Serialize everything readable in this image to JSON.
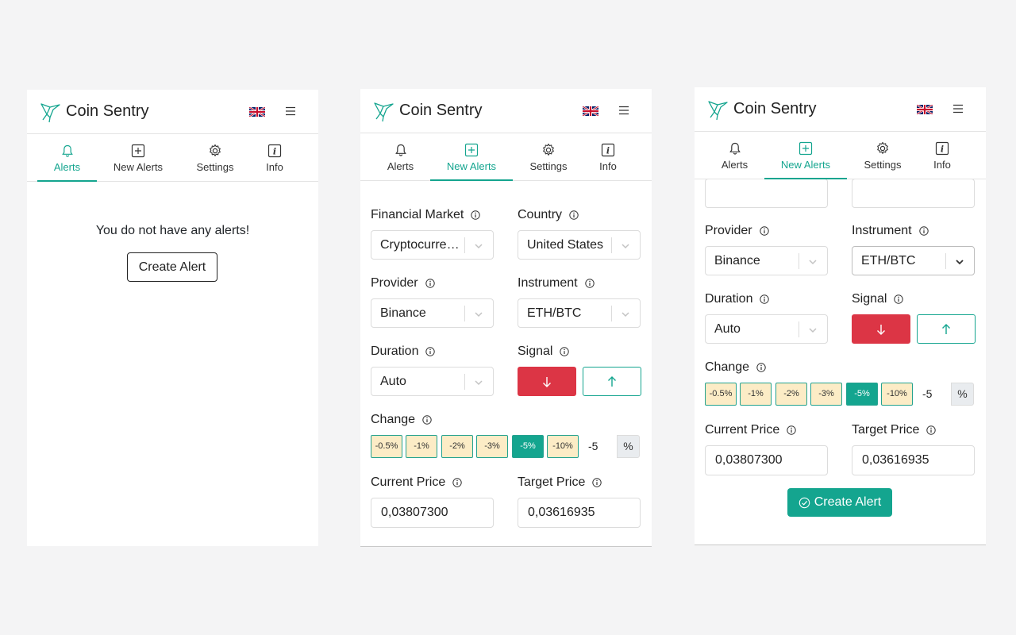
{
  "app": {
    "title": "Coin Sentry",
    "language": "English (UK)"
  },
  "tabs": {
    "alerts": "Alerts",
    "new_alerts": "New Alerts",
    "settings": "Settings",
    "info": "Info"
  },
  "alerts_view": {
    "empty_message": "You do not have any alerts!",
    "create_label": "Create Alert"
  },
  "form": {
    "financial_market": {
      "label": "Financial Market",
      "value": "Cryptocurrency"
    },
    "country": {
      "label": "Country",
      "value": "United States"
    },
    "provider": {
      "label": "Provider",
      "value": "Binance"
    },
    "instrument": {
      "label": "Instrument",
      "value": "ETH/BTC"
    },
    "duration": {
      "label": "Duration",
      "value": "Auto"
    },
    "signal": {
      "label": "Signal",
      "down": "↓",
      "up": "↑",
      "selected": "down"
    },
    "change": {
      "label": "Change",
      "options": [
        "-0.5%",
        "-1%",
        "-2%",
        "-3%",
        "-5%",
        "-10%"
      ],
      "selected": "-5%",
      "input_value": "-5",
      "unit": "%"
    },
    "current_price": {
      "label": "Current Price",
      "value": "0,03807300"
    },
    "target_price": {
      "label": "Target Price",
      "value": "0,03616935"
    },
    "submit_label": "Create Alert"
  },
  "colors": {
    "accent": "#14a58f",
    "danger": "#dc3545",
    "chip_bg": "#fcecc6"
  }
}
